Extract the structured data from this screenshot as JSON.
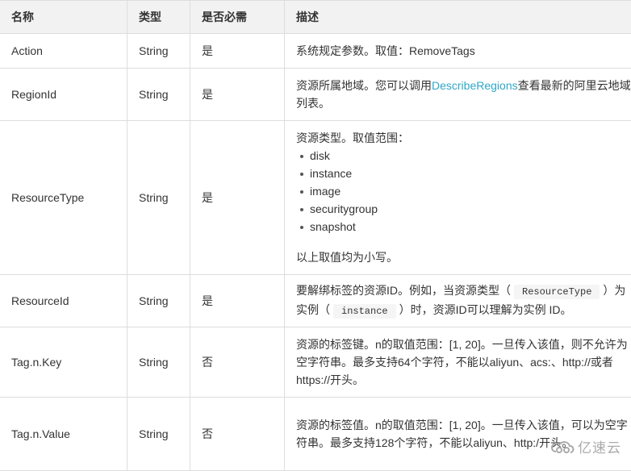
{
  "table": {
    "headers": [
      "名称",
      "类型",
      "是否必需",
      "描述"
    ],
    "rows": [
      {
        "name": "Action",
        "type": "String",
        "required": "是",
        "description": "系统规定参数。取值：RemoveTags"
      },
      {
        "name": "RegionId",
        "type": "String",
        "required": "是",
        "description_before": "资源所属地域。您可以调用",
        "description_link": "DescribeRegions",
        "description_after": "查看最新的阿里云地域列表。"
      },
      {
        "name": "ResourceType",
        "type": "String",
        "required": "是",
        "description_intro": "资源类型。取值范围：",
        "options": [
          "disk",
          "instance",
          "image",
          "securitygroup",
          "snapshot"
        ],
        "description_note": "以上取值均为小写。"
      },
      {
        "name": "ResourceId",
        "type": "String",
        "required": "是",
        "description_part1": "要解绑标签的资源ID。例如，当资源类型（",
        "code1": "ResourceType",
        "description_part2": "）为实例（",
        "code2": "instance",
        "description_part3": "）时，资源ID可以理解为实例 ID。"
      },
      {
        "name": "Tag.n.Key",
        "type": "String",
        "required": "否",
        "description": "资源的标签键。n的取值范围：[1, 20]。一旦传入该值，则不允许为空字符串。最多支持64个字符，不能以aliyun、acs:、http://或者https://开头。"
      },
      {
        "name": "Tag.n.Value",
        "type": "String",
        "required": "否",
        "description": "资源的标签值。n的取值范围：[1, 20]。一旦传入该值，可以为空字符串。最多支持128个字符，不能以aliyun、http:/开头。"
      }
    ]
  },
  "watermark": {
    "icon": "yisu-cloud-logo-icon",
    "text": "亿速云"
  },
  "colors": {
    "link": "#2ea7c9",
    "header_bg": "#f2f2f2",
    "border": "#dddddd"
  }
}
